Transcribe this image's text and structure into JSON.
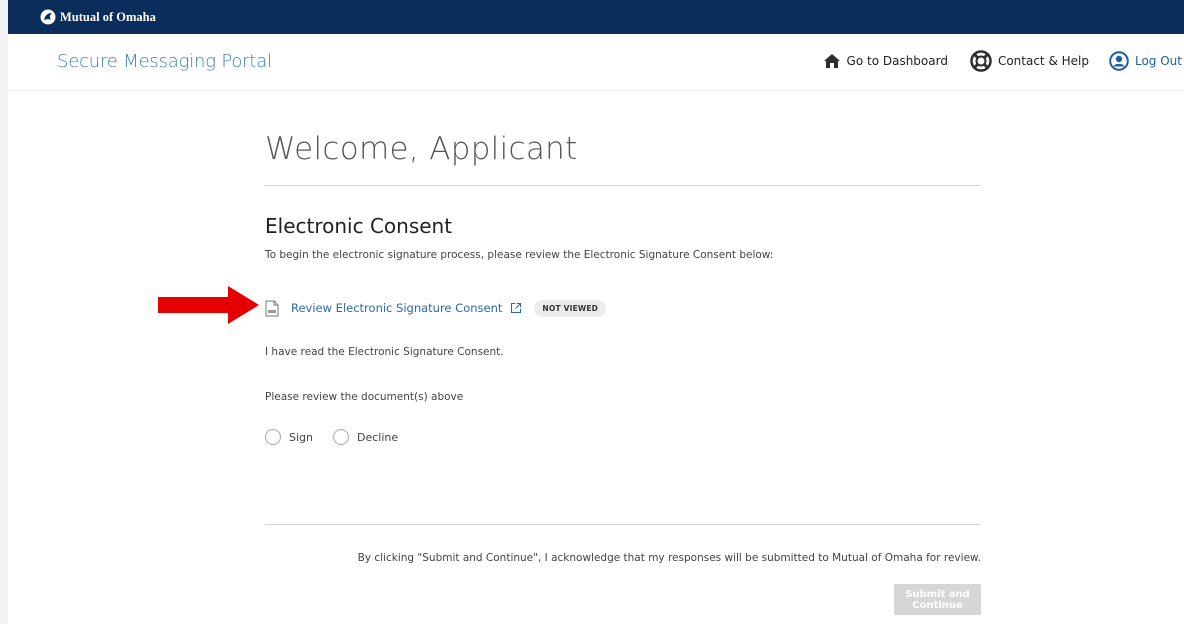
{
  "brand": {
    "name": "Mutual of Omaha"
  },
  "header": {
    "portal_title": "Secure Messaging Portal",
    "nav": {
      "dashboard": "Go to Dashboard",
      "contact": "Contact & Help",
      "logout": "Log Out"
    }
  },
  "main": {
    "welcome": "Welcome, Applicant",
    "section_title": "Electronic Consent",
    "intro": "To begin the electronic signature process, please review the Electronic Signature Consent below:",
    "document": {
      "link_text": "Review Electronic Signature Consent",
      "status": "NOT VIEWED",
      "icon": "document-icon"
    },
    "read_statement": "I have read the Electronic Signature Consent.",
    "review_prompt": "Please review the document(s) above",
    "options": {
      "sign": "Sign",
      "decline": "Decline"
    },
    "acknowledgement": "By clicking \"Submit and Continue\", I acknowledge that my responses will be submitted to Mutual of Omaha for review.",
    "submit_label": "Submit and Continue"
  },
  "colors": {
    "brand_bar": "#0b2d5b",
    "portal_title": "#3c7fb5",
    "link": "#2b6aa6",
    "annotation_arrow": "#e40000",
    "button_disabled": "#d6d6d6"
  },
  "icons": [
    "home-icon",
    "lifebuoy-icon",
    "user-circle-icon",
    "document-icon",
    "external-link-icon",
    "red-arrow-icon"
  ]
}
